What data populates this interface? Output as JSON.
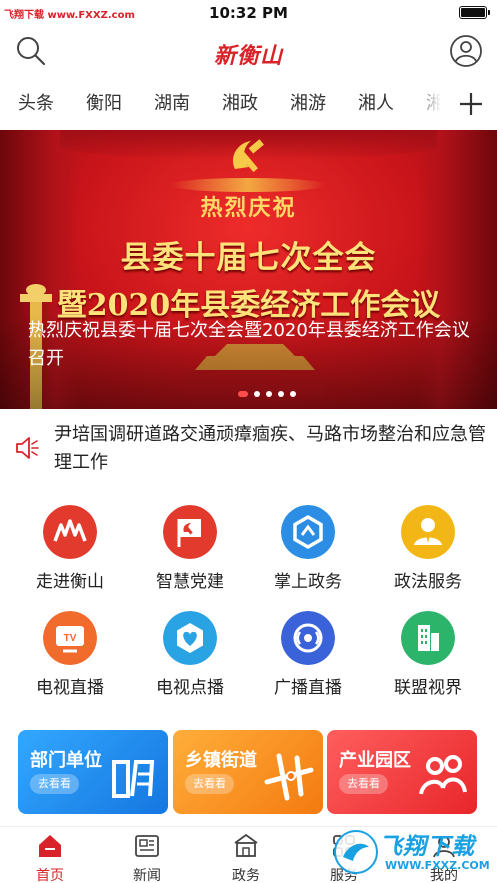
{
  "status_bar": {
    "watermark": "飞翔下载 www.FXXZ.com",
    "time": "10:32 PM"
  },
  "header": {
    "logo_text": "新衡山",
    "search_icon": "search-icon",
    "user_icon": "user-icon"
  },
  "channels": {
    "tabs": [
      "头条",
      "衡阳",
      "湖南",
      "湘政",
      "湘游",
      "湘人",
      "湘"
    ],
    "add_icon": "plus-icon"
  },
  "banner": {
    "subtitle": "热烈庆祝",
    "headline_1": "县委十届七次全会",
    "headline_2": "暨2020年县委经济工作会议",
    "caption": "热烈庆祝县委十届七次全会暨2020年县委经济工作会议召开",
    "slide_count": 5,
    "active_slide": 1
  },
  "notice": {
    "icon": "speaker-icon",
    "text": "尹培国调研道路交通顽瘴痼疾、马路市场整治和应急管理工作"
  },
  "services": [
    {
      "label": "走进衡山",
      "icon": "mountain-icon",
      "color": "#e23b2e"
    },
    {
      "label": "智慧党建",
      "icon": "party-flag-icon",
      "color": "#e23b2e"
    },
    {
      "label": "掌上政务",
      "icon": "hexagon-icon",
      "color": "#2b8de3"
    },
    {
      "label": "政法服务",
      "icon": "person-icon",
      "color": "#f2b716"
    },
    {
      "label": "电视直播",
      "icon": "tv-icon",
      "color": "#f06b2c"
    },
    {
      "label": "电视点播",
      "icon": "heart-icon",
      "color": "#2aa3e5"
    },
    {
      "label": "广播直播",
      "icon": "radio-icon",
      "color": "#3a63d9"
    },
    {
      "label": "联盟视界",
      "icon": "building-icon",
      "color": "#2cb46a"
    }
  ],
  "cards": [
    {
      "title": "部门单位",
      "button": "去看看",
      "color": "#1e96f0"
    },
    {
      "title": "乡镇街道",
      "button": "去看看",
      "color": "#f7921e"
    },
    {
      "title": "产业园区",
      "button": "去看看",
      "color": "#ee3b3b"
    }
  ],
  "tabbar": [
    {
      "label": "首页",
      "icon": "home-icon"
    },
    {
      "label": "新闻",
      "icon": "newspaper-icon"
    },
    {
      "label": "政务",
      "icon": "government-icon"
    },
    {
      "label": "服务",
      "icon": "service-icon"
    },
    {
      "label": "我的",
      "icon": "profile-icon"
    }
  ],
  "watermark_bottom": {
    "text": "飞翔下载",
    "url": "WWW.FXXZ.COM"
  },
  "colors": {
    "brand_red": "#d8232a",
    "watermark_blue": "#1aa1e2"
  }
}
